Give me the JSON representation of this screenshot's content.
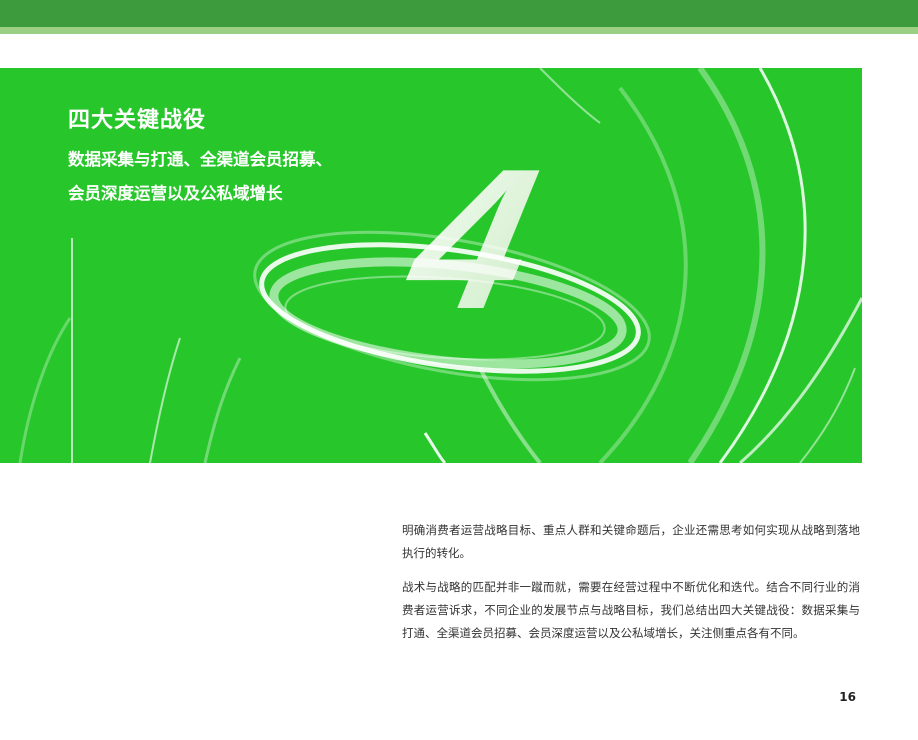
{
  "banner": {
    "title": "四大关键战役",
    "subtitle_line1": "数据采集与打通、全渠道会员招募、",
    "subtitle_line2": "会员深度运营以及公私域增长",
    "numeral": "4",
    "background_color": "#27c72b"
  },
  "header": {
    "bar_color": "#3d9a3d",
    "stripe_color": "#9bcf83"
  },
  "body": {
    "paragraphs": [
      "明确消费者运营战略目标、重点人群和关键命题后，企业还需思考如何实现从战略到落地执行的转化。",
      "战术与战略的匹配并非一蹴而就，需要在经营过程中不断优化和迭代。结合不同行业的消费者运营诉求，不同企业的发展节点与战略目标，我们总结出四大关键战役：数据采集与打通、全渠道会员招募、会员深度运营以及公私域增长，关注侧重点各有不同。"
    ]
  },
  "page_number": "16"
}
